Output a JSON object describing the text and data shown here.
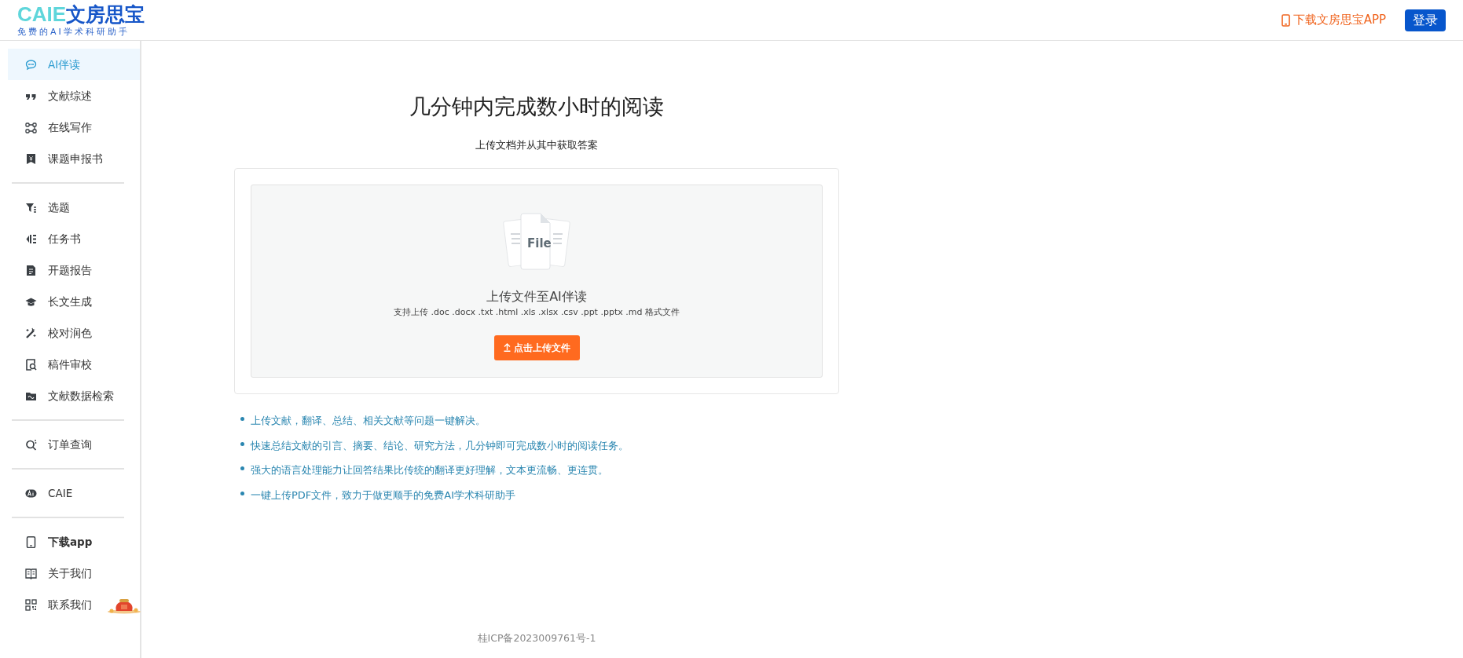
{
  "header": {
    "logo_mark": "CAIE",
    "logo_name": "文房思宝",
    "logo_slogan": "免费的AI学术科研助手",
    "download_link": "下载文房思宝APP",
    "login_button": "登录"
  },
  "sidebar": {
    "groups": [
      {
        "items": [
          {
            "label": "AI伴读",
            "selected": true,
            "bold": false
          },
          {
            "label": "文献综述",
            "selected": false,
            "bold": false
          },
          {
            "label": "在线写作",
            "selected": false,
            "bold": false
          },
          {
            "label": "课题申报书",
            "selected": false,
            "bold": false
          }
        ]
      },
      {
        "items": [
          {
            "label": "选题",
            "selected": false,
            "bold": false
          },
          {
            "label": "任务书",
            "selected": false,
            "bold": false
          },
          {
            "label": "开题报告",
            "selected": false,
            "bold": false
          },
          {
            "label": "长文生成",
            "selected": false,
            "bold": false
          },
          {
            "label": "校对润色",
            "selected": false,
            "bold": false
          },
          {
            "label": "稿件审校",
            "selected": false,
            "bold": false
          },
          {
            "label": "文献数据检索",
            "selected": false,
            "bold": false
          }
        ]
      },
      {
        "items": [
          {
            "label": "订单查询",
            "selected": false,
            "bold": false
          }
        ]
      },
      {
        "items": [
          {
            "label": "CAIE",
            "selected": false,
            "bold": false
          }
        ]
      },
      {
        "items": [
          {
            "label": "下载app",
            "selected": false,
            "bold": true
          },
          {
            "label": "关于我们",
            "selected": false,
            "bold": false
          },
          {
            "label": "联系我们",
            "selected": false,
            "bold": false
          }
        ]
      }
    ]
  },
  "main": {
    "title": "几分钟内完成数小时的阅读",
    "subtitle": "上传文档并从其中获取答案",
    "upload": {
      "icon_label": "File",
      "heading": "上传文件至AI伴读",
      "formats": "支持上传 .doc .docx .txt .html .xls .xlsx .csv .ppt .pptx .md 格式文件",
      "button": "点击上传文件"
    },
    "features": [
      "上传文献，翻译、总结、相关文献等问题一键解决。",
      "快速总结文献的引言、摘要、结论、研究方法，几分钟即可完成数小时的阅读任务。",
      "强大的语言处理能力让回答结果比传统的翻译更好理解，文本更流畅、更连贯。",
      "一键上传PDF文件，致力于做更顺手的免费AI学术科研助手"
    ]
  },
  "footer": {
    "icp": "桂ICP备2023009761号-1"
  }
}
